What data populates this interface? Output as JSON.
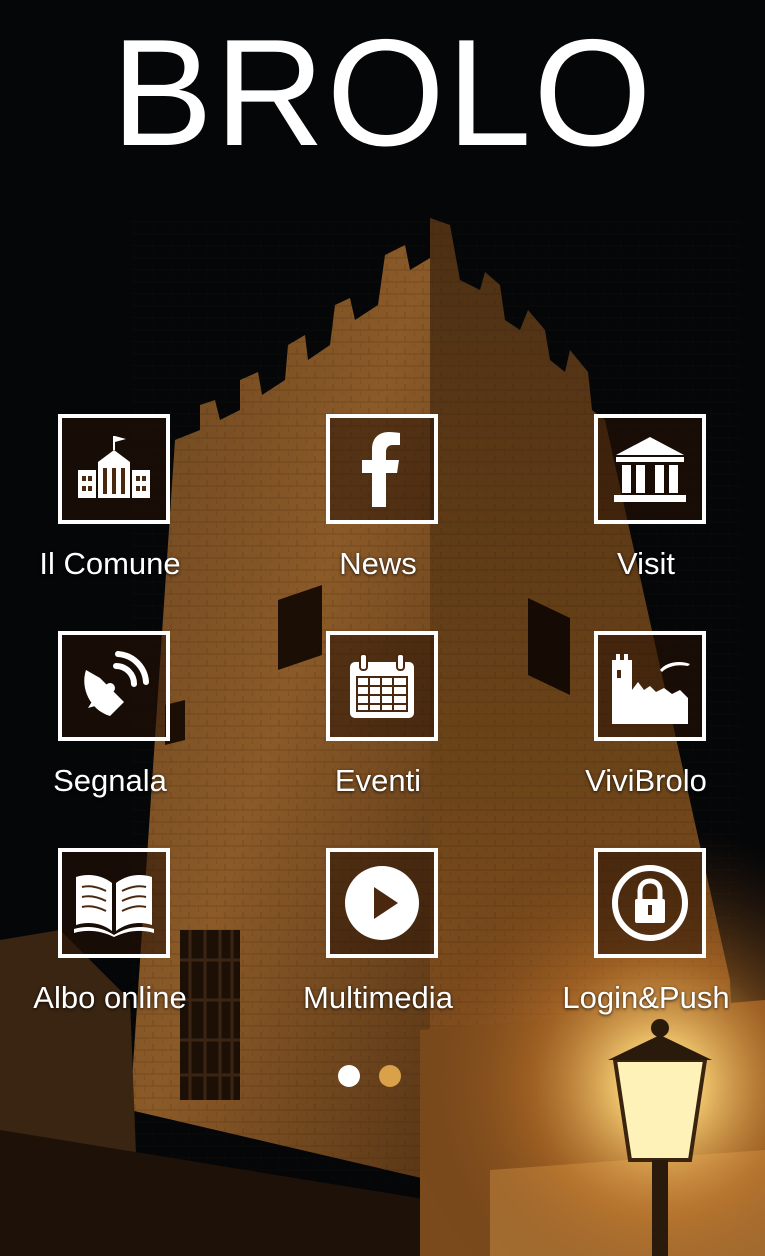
{
  "app": {
    "title": "BROLO"
  },
  "tiles": [
    {
      "label": "Il Comune",
      "icon": "town-hall-icon"
    },
    {
      "label": "News",
      "icon": "facebook-icon"
    },
    {
      "label": "Visit",
      "icon": "museum-icon"
    },
    {
      "label": "Segnala",
      "icon": "satellite-dish-icon"
    },
    {
      "label": "Eventi",
      "icon": "calendar-icon"
    },
    {
      "label": "ViviBrolo",
      "icon": "castle-icon"
    },
    {
      "label": "Albo online",
      "icon": "open-book-icon"
    },
    {
      "label": "Multimedia",
      "icon": "play-icon"
    },
    {
      "label": "Login&Push",
      "icon": "lock-icon"
    }
  ],
  "pager": {
    "pages": 2,
    "current": 1,
    "active_color": "#ffffff",
    "inactive_color": "#d9a24a"
  },
  "colors": {
    "background": "#050608",
    "stone": "#8a5a2a",
    "lamp_glow": "#ffd77a"
  }
}
